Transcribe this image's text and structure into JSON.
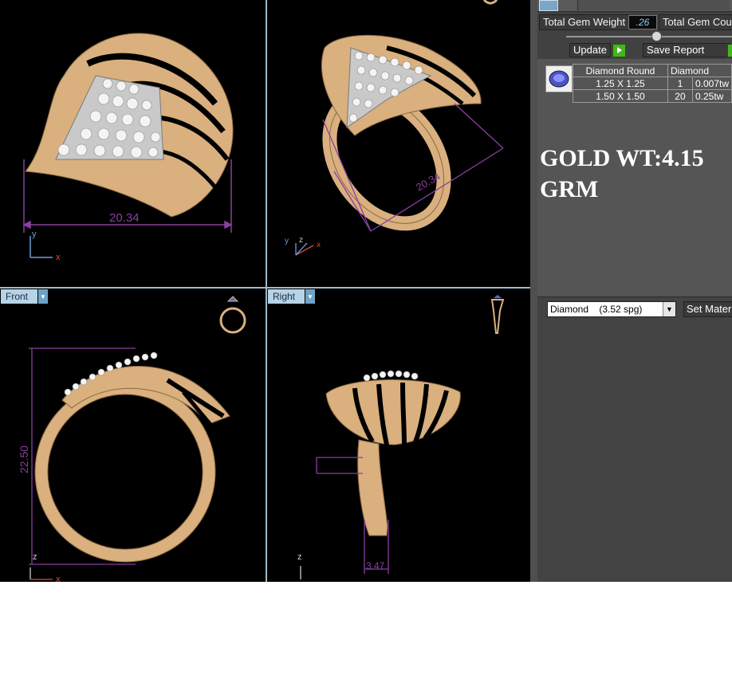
{
  "viewports": {
    "top_left": {
      "dimension": "20.34",
      "axis_x": "x",
      "axis_y": "y"
    },
    "top_right": {
      "dimension": "20.34",
      "axis_x": "x",
      "axis_y": "y",
      "axis_z": "z"
    },
    "front": {
      "label": "Front",
      "dimension": "22.50",
      "axis_x": "x",
      "axis_z": "z"
    },
    "right": {
      "label": "Right",
      "dimension": "3.47",
      "axis_z": "z"
    }
  },
  "panel": {
    "total_gem_weight_label": "Total Gem Weight",
    "total_gem_weight_value": ".26",
    "total_gem_count_label": "Total Gem Cou",
    "update_label": "Update",
    "save_report_label": "Save Report",
    "gem_table": {
      "headers": [
        "Diamond Round",
        "Diamond"
      ],
      "rows": [
        [
          "1.25 X 1.25",
          "1",
          "0.007tw"
        ],
        [
          "1.50 X 1.50",
          "20",
          "0.25tw"
        ]
      ]
    },
    "gold_weight": "GOLD WT:4.15 GRM",
    "material_selected": "Diamond    (3.52 spg)",
    "set_material_label": "Set Materi"
  },
  "colors": {
    "viewport_bg": "#000000",
    "gold": "#d9b07e",
    "dimension": "#8a3fa3",
    "panel_bg": "#414141",
    "accent_green": "#47b41f"
  },
  "icons": [
    "ring-preview-icon",
    "gem-thumbnail-icon",
    "play-icon",
    "dropdown-arrow-icon"
  ]
}
